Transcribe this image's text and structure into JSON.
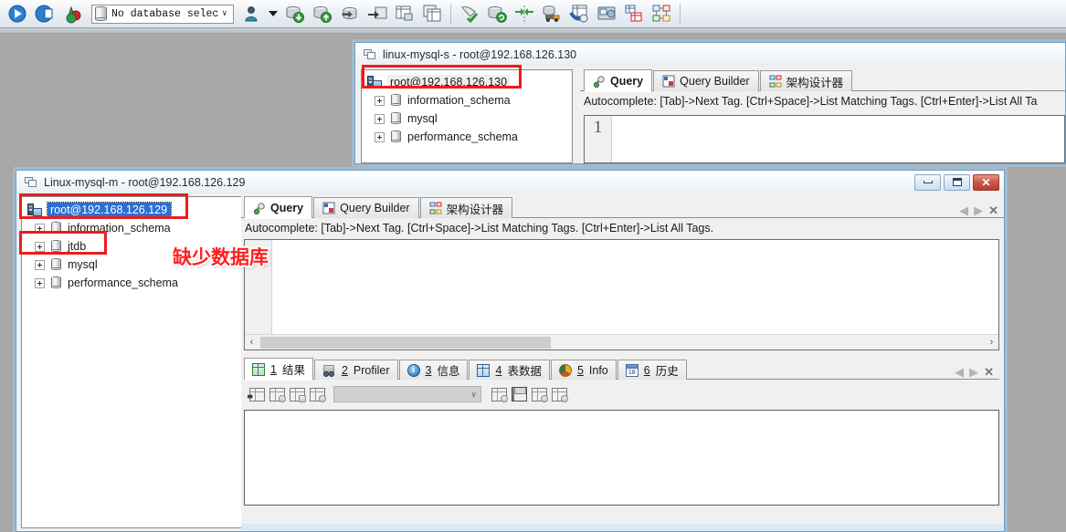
{
  "desktop": {
    "bg_color": "#a8a8a8"
  },
  "toolbar": {
    "db_selector": {
      "value": "No database select",
      "icon": "database-icon",
      "chevron": "∨"
    },
    "buttons": [
      {
        "name": "connect-icon"
      },
      {
        "name": "open-connection-icon"
      },
      {
        "name": "new-object-icon"
      },
      {
        "name": "user-manager-icon"
      },
      {
        "name": "user-dropdown-arrow-icon"
      },
      {
        "name": "backup-icon"
      },
      {
        "name": "restore-icon"
      },
      {
        "name": "import-icon"
      },
      {
        "name": "export-icon"
      },
      {
        "name": "table-export-icon"
      },
      {
        "name": "duplicate-table-icon"
      },
      {
        "name": "validate-icon"
      },
      {
        "name": "refresh-db-icon"
      },
      {
        "name": "compare-icon"
      },
      {
        "name": "transfer-icon"
      },
      {
        "name": "sync-icon"
      },
      {
        "name": "monitor-icon"
      },
      {
        "name": "report-icon"
      },
      {
        "name": "schema-designer-icon"
      }
    ]
  },
  "back_window": {
    "title": "linux-mysql-s - root@192.168.126.130",
    "tree": {
      "root": {
        "label": "root@192.168.126.130",
        "icon": "server-icon",
        "highlighted": true
      },
      "children": [
        {
          "label": "information_schema",
          "icon": "database-icon"
        },
        {
          "label": "mysql",
          "icon": "database-icon"
        },
        {
          "label": "performance_schema",
          "icon": "database-icon"
        }
      ]
    },
    "tabs": [
      {
        "label": "Query",
        "icon": "query-icon",
        "active": true
      },
      {
        "label": "Query Builder",
        "icon": "query-builder-icon",
        "active": false
      },
      {
        "label": "架构设计器",
        "icon": "schema-designer-icon",
        "active": false
      }
    ],
    "autocomplete_hint": "Autocomplete: [Tab]->Next Tag. [Ctrl+Space]->List Matching Tags. [Ctrl+Enter]->List All Ta",
    "editor": {
      "line_number": "1",
      "content": ""
    }
  },
  "front_window": {
    "title": "Linux-mysql-m - root@192.168.126.129",
    "window_buttons": {
      "minimize": {
        "name": "minimize-button",
        "glyph": "—"
      },
      "maximize": {
        "name": "maximize-button",
        "glyph": "□"
      },
      "close": {
        "name": "close-button",
        "glyph": "✕"
      }
    },
    "tree": {
      "root": {
        "label": "root@192.168.126.129",
        "icon": "server-icon",
        "selected": true
      },
      "children": [
        {
          "label": "information_schema",
          "icon": "database-icon"
        },
        {
          "label": "jtdb",
          "icon": "database-icon"
        },
        {
          "label": "mysql",
          "icon": "database-icon"
        },
        {
          "label": "performance_schema",
          "icon": "database-icon"
        }
      ]
    },
    "tabs": [
      {
        "label": "Query",
        "icon": "query-icon",
        "active": true
      },
      {
        "label": "Query Builder",
        "icon": "query-builder-icon",
        "active": false
      },
      {
        "label": "架构设计器",
        "icon": "schema-designer-icon",
        "active": false
      }
    ],
    "tab_nav": {
      "prev": "◀",
      "next": "▶",
      "close": "✕"
    },
    "autocomplete_hint": "Autocomplete: [Tab]->Next Tag. [Ctrl+Space]->List Matching Tags. [Ctrl+Enter]->List All Tags.",
    "editor": {
      "line_number": "",
      "content": ""
    },
    "hscroll": {
      "left_arrow": "‹",
      "right_arrow": "›"
    },
    "result_tabs": [
      {
        "num": "1",
        "label": "结果",
        "icon": "result-grid-icon",
        "active": true
      },
      {
        "num": "2",
        "label": "Profiler",
        "icon": "profiler-icon",
        "active": false
      },
      {
        "num": "3",
        "label": "信息",
        "icon": "info-circle-icon",
        "active": false
      },
      {
        "num": "4",
        "label": "表数据",
        "icon": "table-data-icon",
        "active": false
      },
      {
        "num": "5",
        "label": "Info",
        "icon": "pie-chart-icon",
        "active": false
      },
      {
        "num": "6",
        "label": "历史",
        "icon": "calendar-icon",
        "active": false
      }
    ],
    "result_tab_nav": {
      "prev": "◀",
      "next": "▶",
      "close": "✕"
    },
    "result_toolbar": {
      "buttons": [
        {
          "name": "insert-row-button"
        },
        {
          "name": "copy-row-button"
        },
        {
          "name": "duplicate-row-button"
        },
        {
          "name": "delete-row-button"
        },
        {
          "name": "export-grid-button"
        },
        {
          "name": "save-grid-button"
        },
        {
          "name": "import-grid-button"
        },
        {
          "name": "refresh-grid-button"
        }
      ],
      "combo": {
        "value": "",
        "chevron": "∨"
      }
    }
  },
  "annotations": [
    {
      "name": "missing-database-note",
      "text": "缺少数据库",
      "color": "#ff2020"
    }
  ],
  "highlight_boxes": [
    {
      "name": "back-root-node-highlight",
      "color": "#ee1c1c"
    },
    {
      "name": "front-root-node-highlight",
      "color": "#ee1c1c"
    },
    {
      "name": "jtdb-node-highlight",
      "color": "#ee1c1c"
    }
  ]
}
